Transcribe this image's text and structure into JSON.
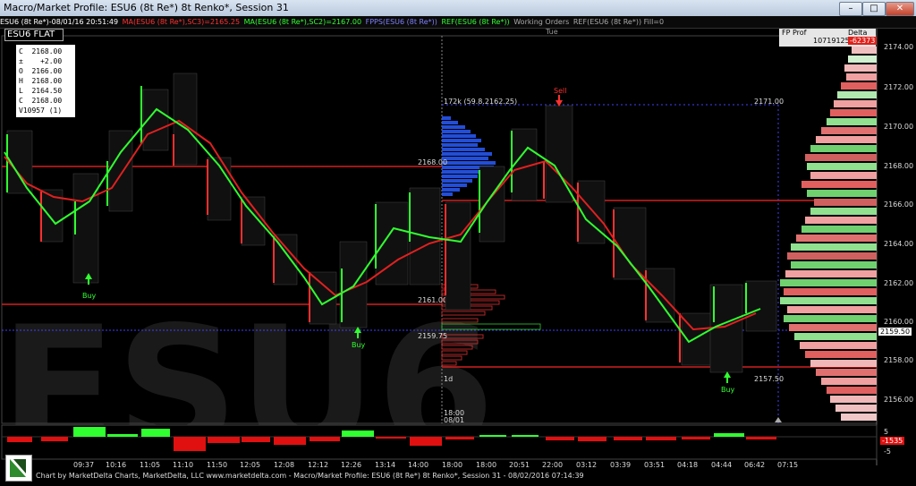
{
  "window": {
    "title": "Macro/Market Profile: ESU6 (8t Re*) 8t Renko*, Session 31",
    "buttons": [
      "–",
      "□",
      "✕"
    ]
  },
  "legend": [
    {
      "text": "ESU6 (8t Re*)-08/01/16 20:51:49",
      "color": "#ffffff"
    },
    {
      "text": "MA(ESU6 (8t Re*),SC3)=2165.25",
      "color": "#ff3030"
    },
    {
      "text": "MA(ESU6 (8t Re*),SC2)=2167.00",
      "color": "#30ff30"
    },
    {
      "text": "FPPS(ESU6 (8t Re*))",
      "color": "#8080ff"
    },
    {
      "text": "REF(ESU6 (8t Re*))",
      "color": "#30ff30"
    },
    {
      "text": "Working Orders",
      "color": "#aaaaaa"
    },
    {
      "text": "REF(ESU6 (8t Re*)) Fill=0",
      "color": "#aaaaaa"
    }
  ],
  "symbol_box": "ESU6 FLAT",
  "ohlc": [
    {
      "label": "C",
      "value": "2168.00"
    },
    {
      "label": "±",
      "value": "+2.00"
    },
    {
      "label": "O",
      "value": "2166.00"
    },
    {
      "label": "H",
      "value": "2168.00"
    },
    {
      "label": "L",
      "value": "2164.50"
    },
    {
      "label": "C",
      "value": "2168.00"
    },
    {
      "label": "V10957",
      "value": "(1)"
    }
  ],
  "fp_prof": {
    "label": "FP Prof",
    "delta_label": "Delta",
    "volume": "10719125",
    "delta": "-62373"
  },
  "watermark": "ESU6",
  "price_labels_in_chart": [
    "2168.00",
    "2161.00",
    "2159.75",
    "2157.50",
    "2171.00",
    "172k (59.8.2162.25)",
    "1d",
    "18:00",
    "08/01",
    "Tue"
  ],
  "signals": [
    {
      "text": "Buy",
      "color": "#30ff30"
    },
    {
      "text": "Buy",
      "color": "#30ff30"
    },
    {
      "text": "Sell",
      "color": "#ff3030"
    },
    {
      "text": "Buy",
      "color": "#30ff30"
    }
  ],
  "price_axis": [
    "2174.00",
    "2172.00",
    "2170.00",
    "2168.00",
    "2166.00",
    "2164.00",
    "2162.00",
    "2160.00",
    "2158.00",
    "2156.00"
  ],
  "price_axis_current": "2159.50",
  "lower_axis": {
    "top": "5",
    "bottom": "-5",
    "value": "-1535"
  },
  "time_axis": [
    "09:37",
    "10:16",
    "11:05",
    "11:10",
    "11:50",
    "12:05",
    "12:08",
    "12:12",
    "12:26",
    "13:14",
    "14:00",
    "18:00",
    "18:00",
    "20:51",
    "22:00",
    "03:12",
    "03:39",
    "03:51",
    "04:18",
    "04:44",
    "06:42",
    "07:15"
  ],
  "footer": "Chart by MarketDelta Charts, MarketDelta, LLC www.marketdelta.com - Macro/Market Profile: ESU6 (8t Re*) 8t Renko*, Session 31 - 08/02/2016 07:14:39",
  "colors": {
    "up": "#30ff30",
    "down": "#ff3030",
    "profile_blue": "#2a5cff",
    "background": "#000000"
  }
}
